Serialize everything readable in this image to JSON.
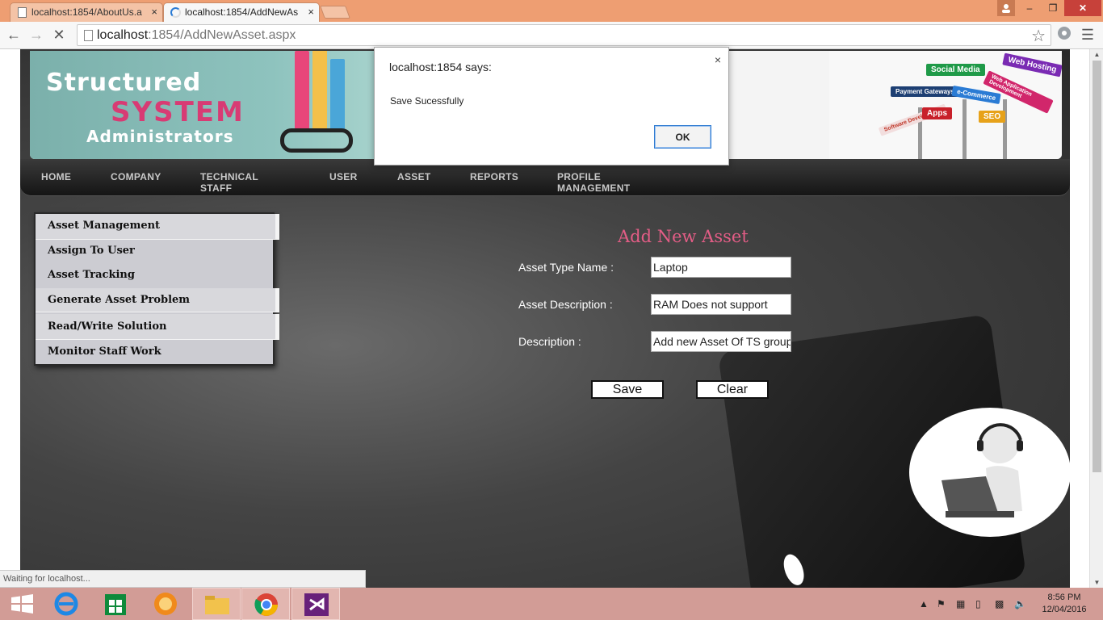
{
  "browser": {
    "tabs": [
      {
        "label": "localhost:1854/AboutUs.a"
      },
      {
        "label": "localhost:1854/AddNewAs"
      }
    ],
    "tab_close": "×",
    "window_controls": {
      "minimize": "‒",
      "maximize": "❐",
      "close": "✕"
    },
    "url_host": "localhost",
    "url_rest": ":1854/AddNewAsset.aspx",
    "status": "Waiting for localhost..."
  },
  "banner": {
    "logo_line1": "Structured",
    "logo_line2": "SYSTEM",
    "logo_line3": "Administrators",
    "signs": [
      "Social Media",
      "Web Hosting",
      "Payment Gateways",
      "e-Commerce",
      "Web Application Development",
      "Software Development",
      "Apps",
      "SEO"
    ]
  },
  "nav": {
    "items": [
      "HOME",
      "COMPANY",
      "TECHNICAL STAFF",
      "USER",
      "ASSET",
      "REPORTS",
      "PROFILE MANAGEMENT"
    ]
  },
  "sidemenu": {
    "items": [
      "Asset Management",
      "Assign To User",
      "Asset Tracking",
      "Generate Asset Problem",
      "Read/Write Solution",
      "Monitor Staff Work"
    ]
  },
  "form": {
    "title": "Add New Asset",
    "fields": [
      {
        "label": "Asset Type Name :",
        "value": "Laptop"
      },
      {
        "label": "Asset Description :",
        "value": "RAM Does not support"
      },
      {
        "label": "Description :",
        "value": "Add new Asset Of TS group"
      }
    ],
    "save_label": "Save",
    "clear_label": "Clear"
  },
  "dialog": {
    "title": "localhost:1854 says:",
    "message": "Save Sucessfully",
    "ok_label": "OK",
    "close": "×"
  },
  "taskbar": {
    "time": "8:56 PM",
    "date": "12/04/2016"
  },
  "colors": {
    "form_title": "#e35d86",
    "titlebar": "#ee9e72",
    "taskbar": "#d29c96",
    "logo_accent": "#d83b74"
  }
}
